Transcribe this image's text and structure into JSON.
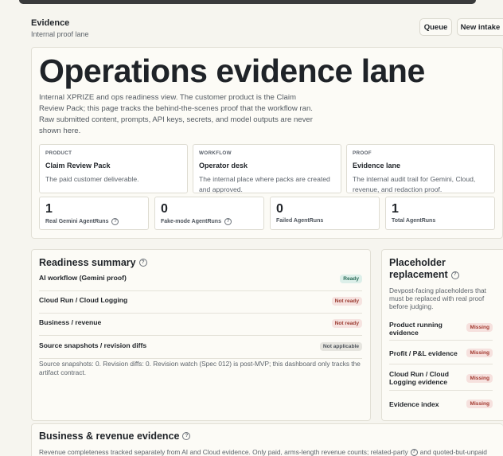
{
  "header": {
    "title": "Evidence",
    "subtitle": "Internal proof lane"
  },
  "actions": {
    "queue": "Queue",
    "new_intake": "New intake"
  },
  "hero": {
    "title": "Operations evidence lane",
    "text": "Internal XPRIZE and ops readiness view. The customer product is the Claim Review Pack; this page tracks the behind-the-scenes proof that the workflow ran. Raw submitted content, prompts, API keys, secrets, and model outputs are never shown here."
  },
  "tiles": [
    {
      "kicker": "PRODUCT",
      "title": "Claim Review Pack",
      "desc": "The paid customer deliverable."
    },
    {
      "kicker": "WORKFLOW",
      "title": "Operator desk",
      "desc": "The internal place where packs are created and approved."
    },
    {
      "kicker": "PROOF",
      "title": "Evidence lane",
      "desc": "The internal audit trail for Gemini, Cloud, revenue, and redaction proof."
    }
  ],
  "metrics": [
    {
      "value": "1",
      "label": "Real Gemini AgentRuns",
      "help": true
    },
    {
      "value": "0",
      "label": "Fake-mode AgentRuns",
      "help": true
    },
    {
      "value": "0",
      "label": "Failed AgentRuns",
      "help": false
    },
    {
      "value": "1",
      "label": "Total AgentRuns",
      "help": false
    }
  ],
  "readiness": {
    "title": "Readiness summary",
    "rows": [
      {
        "label": "AI workflow (Gemini proof)",
        "status": "Ready",
        "kind": "ready"
      },
      {
        "label": "Cloud Run / Cloud Logging",
        "status": "Not ready",
        "kind": "notready"
      },
      {
        "label": "Business / revenue",
        "status": "Not ready",
        "kind": "notready"
      },
      {
        "label": "Source snapshots / revision diffs",
        "status": "Not applicable",
        "kind": "na"
      }
    ],
    "note": "Source snapshots: 0. Revision diffs: 0. Revision watch (Spec 012) is post-MVP; this dashboard only tracks the artifact contract."
  },
  "placeholder": {
    "title_line1": "Placeholder",
    "title_line2": "replacement",
    "desc": "Devpost-facing placeholders that must be replaced with real proof before judging.",
    "rows": [
      {
        "label": "Product running evidence",
        "status": "Missing"
      },
      {
        "label": "Profit / P&L evidence",
        "status": "Missing"
      },
      {
        "label": "Cloud Run / Cloud Logging evidence",
        "status": "Missing"
      },
      {
        "label": "Evidence index",
        "status": "Missing"
      }
    ]
  },
  "business": {
    "title": "Business & revenue evidence",
    "text_start": "Revenue completeness tracked separately from AI and Cloud evidence. Only paid, arms-length revenue counts; related-party",
    "text_end": "and quoted-but-unpaid"
  },
  "help_glyph": "?",
  "colors": {
    "ready": "#2b6b58",
    "not_ready": "#9b3a30",
    "missing": "#a33a30",
    "background": "#f6f5ef"
  }
}
